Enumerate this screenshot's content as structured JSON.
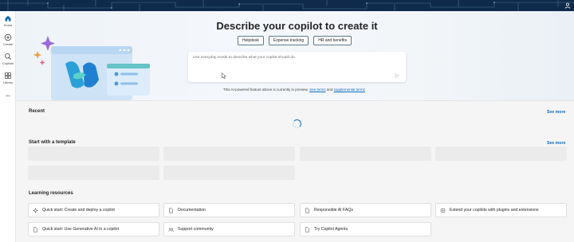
{
  "rail": {
    "items": [
      {
        "label": "Home",
        "icon": "home-icon"
      },
      {
        "label": "Create",
        "icon": "plus-circle-icon"
      },
      {
        "label": "Copilots",
        "icon": "copilot-icon"
      },
      {
        "label": "Library",
        "icon": "library-icon"
      },
      {
        "label": "...",
        "icon": "more-icon"
      }
    ]
  },
  "hero": {
    "title": "Describe your copilot to create it",
    "chips": [
      "Helpdesk",
      "Expense tracking",
      "HR and benefits"
    ],
    "prompt_placeholder": "Use everyday words to describe what your copilot should do",
    "disclaimer_text": "This AI-powered feature above is currently in preview.",
    "link_terms": "See terms",
    "link_and": "and",
    "link_supplemental": "supplemental terms"
  },
  "recent": {
    "title": "Recent",
    "see_more": "See more"
  },
  "templates": {
    "title": "Start with a template",
    "see_more": "See more"
  },
  "learning": {
    "title": "Learning resources",
    "items": [
      {
        "label": "Quick start: Create and deploy a copilot",
        "icon": "sparkle-icon"
      },
      {
        "label": "Documentation",
        "icon": "document-icon"
      },
      {
        "label": "Responsible AI FAQs",
        "icon": "document-icon"
      },
      {
        "label": "Extend your copilots with plugins and extensions",
        "icon": "extension-icon"
      },
      {
        "label": "Quick start: Use Generative AI in a copilot",
        "icon": "document-icon"
      },
      {
        "label": "Support community",
        "icon": "people-icon"
      },
      {
        "label": "Try Copilot Agents",
        "icon": "document-icon"
      }
    ]
  },
  "colors": {
    "accent": "#0f6cbd",
    "banner": "#0f2a4a",
    "chip_border": "#5b7a86"
  }
}
